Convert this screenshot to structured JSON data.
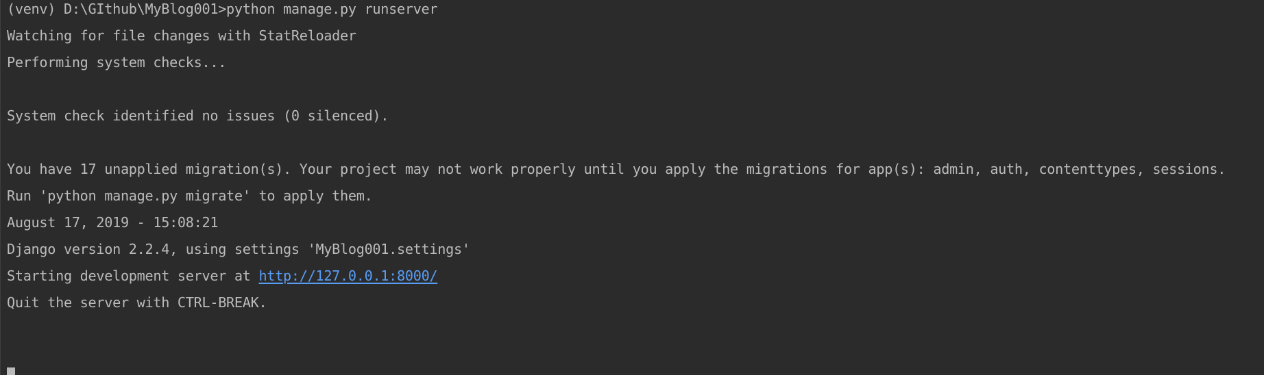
{
  "terminal": {
    "lines": [
      "(venv) D:\\GIthub\\MyBlog001>python manage.py runserver",
      "Watching for file changes with StatReloader",
      "Performing system checks...",
      "",
      "System check identified no issues (0 silenced).",
      "",
      "You have 17 unapplied migration(s). Your project may not work properly until you apply the migrations for app(s): admin, auth, contenttypes, sessions.",
      "Run 'python manage.py migrate' to apply them.",
      "August 17, 2019 - 15:08:21",
      "Django version 2.2.4, using settings 'MyBlog001.settings'"
    ],
    "server_prefix": "Starting development server at ",
    "server_url": "http://127.0.0.1:8000/",
    "quit_line": "Quit the server with CTRL-BREAK."
  },
  "colors": {
    "background": "#2b2b2b",
    "text": "#bbbbbb",
    "link": "#589df6"
  }
}
